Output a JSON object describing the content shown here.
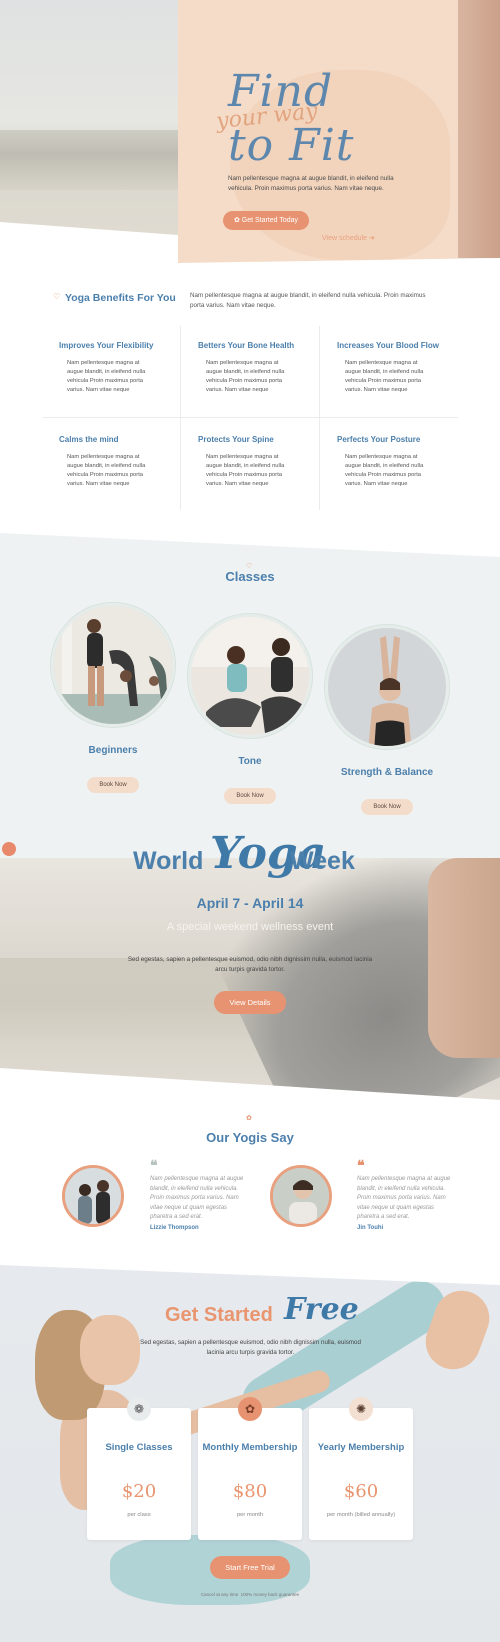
{
  "hero": {
    "title_line1": "Find",
    "title_script": "your way",
    "title_line2": "to Fit",
    "text": "Nam pellentesque magna at augue blandit, in eleifend nulla vehicula. Proin maximus porta varius. Nam vitae neque.",
    "cta_label": "Get Started Today",
    "link_label": "View schedule"
  },
  "benefits": {
    "title": "Yoga Benefits For You",
    "intro": "Nam pellentesque magna at augue blandit, in eleifend nulla vehicula. Proin maximus porta varius. Nam vitae neque.",
    "items": [
      {
        "title": "Improves Your Flexibility",
        "text": "Nam pellentesque magna at augue blandit, in eleifend nulla vehicula Proin maximus porta varius. Nam vitae neque"
      },
      {
        "title": "Betters Your Bone Health",
        "text": "Nam pellentesque magna at augue blandit, in eleifend nulla vehicula Proin maximus porta varius. Nam vitae neque"
      },
      {
        "title": "Increases Your Blood Flow",
        "text": "Nam pellentesque magna at augue blandit, in eleifend nulla vehicula Proin maximus porta varius. Nam vitae neque"
      },
      {
        "title": "Calms the mind",
        "text": "Nam pellentesque magna at augue blandit, in eleifend nulla vehicula Proin maximus porta varius. Nam vitae neque"
      },
      {
        "title": "Protects Your Spine",
        "text": "Nam pellentesque magna at augue blandit, in eleifend nulla vehicula Proin maximus porta varius. Nam vitae neque"
      },
      {
        "title": "Perfects Your Posture",
        "text": "Nam pellentesque magna at augue blandit, in eleifend nulla vehicula Proin maximus porta varius. Nam vitae neque"
      }
    ]
  },
  "classes": {
    "title": "Classes",
    "items": [
      {
        "name": "Beginners",
        "button": "Book Now"
      },
      {
        "name": "Tone",
        "button": "Book Now"
      },
      {
        "name": "Strength & Balance",
        "button": "Book Now"
      }
    ]
  },
  "yoga_week": {
    "title_a": "World",
    "title_script": "Yoga",
    "title_b": "Week",
    "dates": "April 7 - April 14",
    "subtitle": "A special weekend wellness event",
    "text": "Sed egestas, sapien a pellentesque euismod, odio nibh dignissim nulla, euismod lacinia arcu turpis gravida tortor.",
    "button": "View Details"
  },
  "yogis": {
    "title": "Our Yogis Say",
    "items": [
      {
        "quote": "Nam pellentesque magna at augue blandit, in eleifend nulla vehicula. Proin maximus porta varius. Nam vitae neque ut quam egestas pharetra a sed erat.",
        "name": "Lizzie Thompson"
      },
      {
        "quote": "Nam pellentesque magna at augue blandit, in eleifend nulla vehicula. Proin maximus porta varius. Nam vitae neque ut quam egestas pharetra a sed erat.",
        "name": "Jin Touhi"
      }
    ]
  },
  "pricing": {
    "title_a": "Get Started",
    "title_script": "Free",
    "text": "Sed egestas, sapien a pellentesque euismod, odio nibh dignissim nulla, euismod lacinia arcu turpis gravida tortor.",
    "plans": [
      {
        "name": "Single Classes",
        "price": "$20",
        "period": "per class"
      },
      {
        "name": "Monthly Membership",
        "price": "$80",
        "period": "per month"
      },
      {
        "name": "Yearly Membership",
        "price": "$60",
        "period": "per month (billed annually)"
      }
    ],
    "button": "Start Free Trial",
    "note": "Cancel at any time. 100% money back guarantee"
  },
  "colors": {
    "accent_orange": "#e79371",
    "brand_blue": "#4b7fac",
    "peach": "#f5dcc8"
  }
}
